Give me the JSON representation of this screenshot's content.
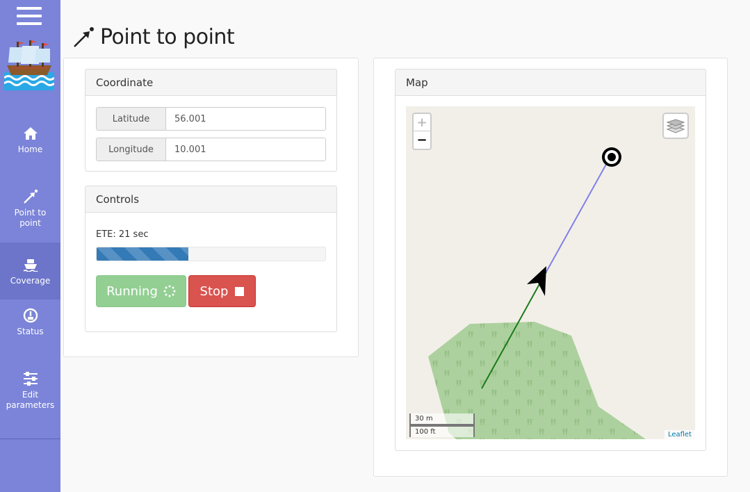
{
  "page": {
    "title": "Point to point"
  },
  "sidebar": {
    "items": [
      {
        "label": "Home",
        "icon": "home-icon"
      },
      {
        "label": "Point to point",
        "icon": "arrow-icon"
      },
      {
        "label": "Coverage",
        "icon": "ship-icon"
      },
      {
        "label": "Status",
        "icon": "gauge-icon"
      },
      {
        "label": "Edit parameters",
        "icon": "sliders-icon"
      }
    ],
    "active": "Coverage"
  },
  "coordinate": {
    "header": "Coordinate",
    "latitude_label": "Latitude",
    "latitude_value": "56.001",
    "longitude_label": "Longitude",
    "longitude_value": "10.001"
  },
  "controls": {
    "header": "Controls",
    "ete": "ETE: 21 sec",
    "progress": 0.4,
    "running_label": "Running",
    "stop_label": "Stop"
  },
  "map": {
    "header": "Map",
    "zoom_in": "+",
    "zoom_out": "−",
    "scale_metric": "30 m",
    "scale_imperial": "100 ft",
    "attribution": "Leaflet"
  },
  "colors": {
    "sidebar": "#7b84d8",
    "progress": "#337ab7",
    "running": "#93cf93",
    "stop": "#d9534f",
    "route_done": "#1a7a1a",
    "route_remaining": "#8080e8",
    "forest": "#add19e"
  }
}
